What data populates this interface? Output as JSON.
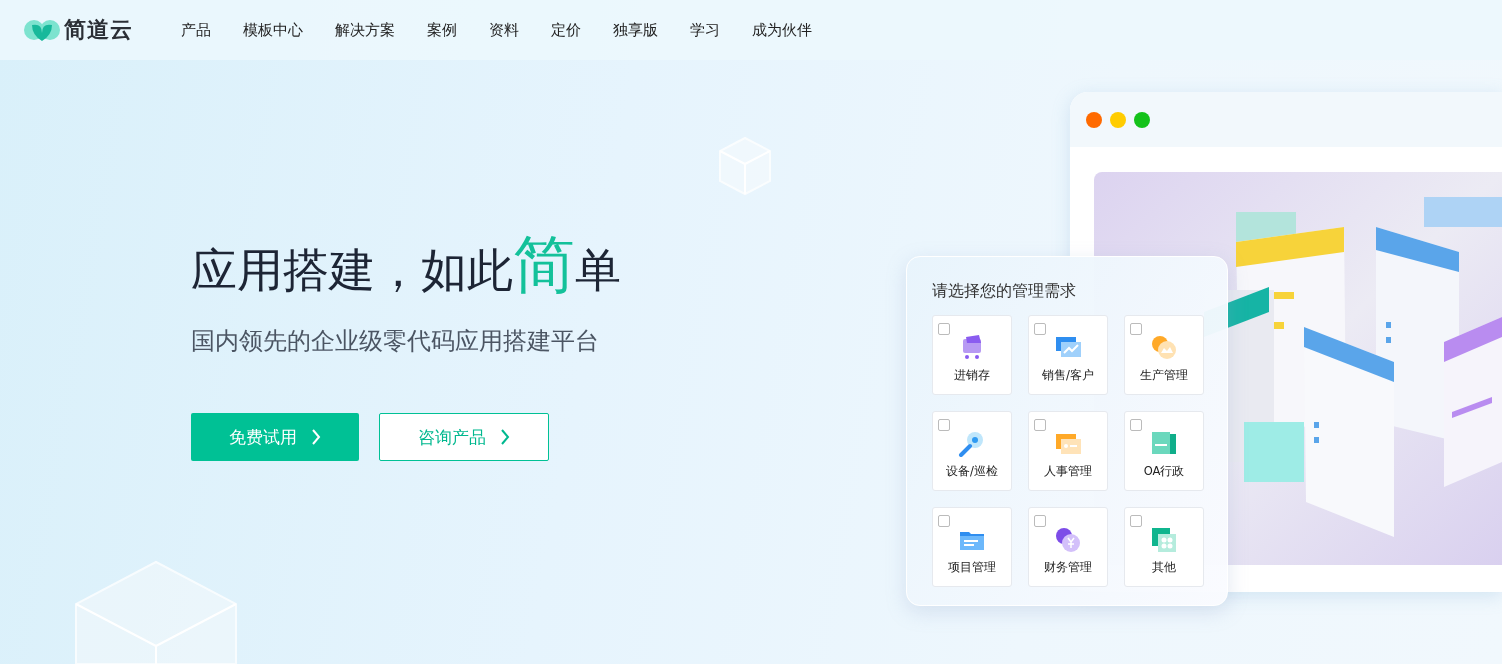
{
  "logo": {
    "text": "简道云"
  },
  "nav": [
    "产品",
    "模板中心",
    "解决方案",
    "案例",
    "资料",
    "定价",
    "独享版",
    "学习",
    "成为伙伴"
  ],
  "hero": {
    "headline": "应用搭建，如此**简**单",
    "subtitle": "国内领先的企业级零代码应用搭建平台",
    "buttons": [
      {
        "label": "免费试用",
        "kind": "primary"
      },
      {
        "label": "咨询产品",
        "kind": "outline"
      }
    ]
  },
  "preview_window": {
    "illustration": {
      "kind": "drawing"
    }
  },
  "needs_card": {
    "title": "请选择您的管理需求",
    "options": [
      {
        "label": "进销存",
        "checked": false
      },
      {
        "label": "销售/客户",
        "checked": false
      },
      {
        "label": "生产管理",
        "checked": false
      },
      {
        "label": "设备/巡检",
        "checked": false
      },
      {
        "label": "人事管理",
        "checked": false
      },
      {
        "label": "OA行政",
        "checked": false
      },
      {
        "label": "项目管理",
        "checked": false
      },
      {
        "label": "财务管理",
        "checked": false
      },
      {
        "label": "其他",
        "checked": false
      }
    ]
  }
}
